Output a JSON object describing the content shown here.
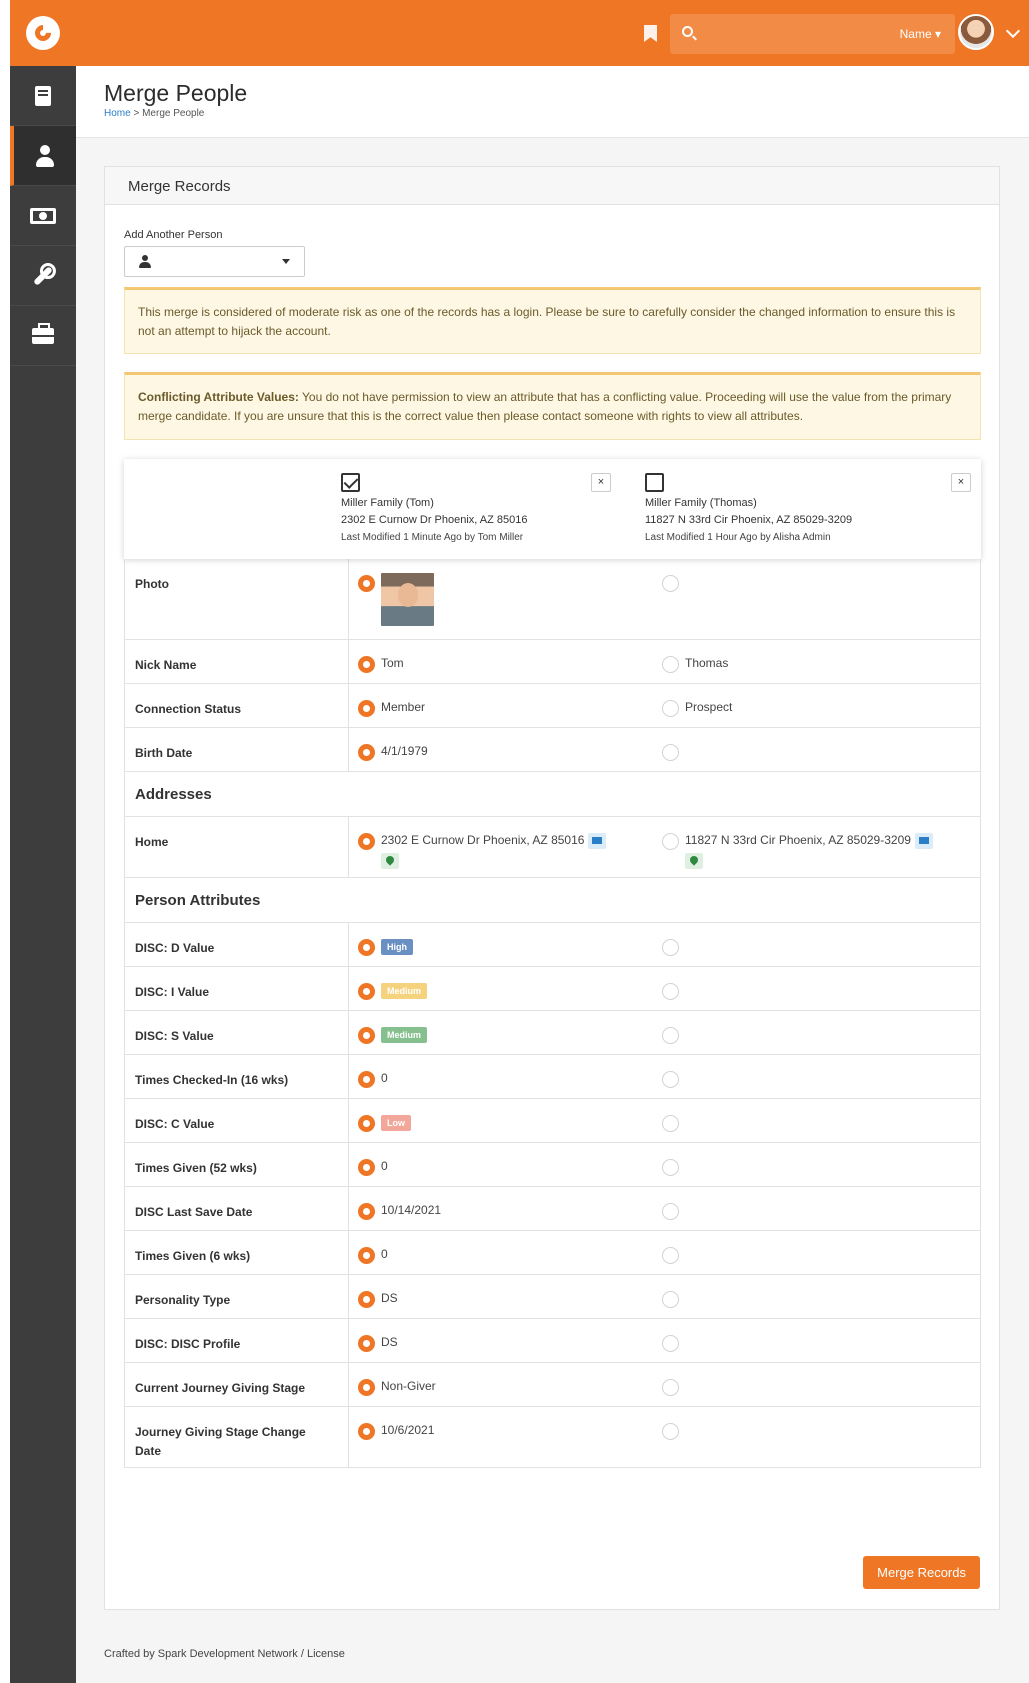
{
  "topbar": {
    "search_scope": "Name ▾",
    "colors": {
      "brand": "#ee7625",
      "sidebar": "#3d3d3d"
    }
  },
  "sidebar": {
    "items": [
      {
        "icon": "book-icon"
      },
      {
        "icon": "person-icon",
        "active": true
      },
      {
        "icon": "money-icon"
      },
      {
        "icon": "wrench-icon"
      },
      {
        "icon": "briefcase-icon"
      }
    ]
  },
  "page": {
    "title": "Merge People",
    "breadcrumb_home": "Home",
    "breadcrumb_sep": ">",
    "breadcrumb_current": "Merge People"
  },
  "panel": {
    "title": "Merge Records",
    "add_person_label": "Add Another Person",
    "alert_risk": "This merge is considered of moderate risk as one of the records has a login. Please be sure to carefully consider the changed information to ensure this is not an attempt to hijack the account.",
    "alert_conflict_title": "Conflicting Attribute Values:",
    "alert_conflict_body": " You do not have permission to view an attribute that has a conflicting value. Proceeding will use the value from the primary merge candidate. If you are unsure that this is the correct value then please contact someone with rights to view all attributes.",
    "merge_button": "Merge Records"
  },
  "candidates": [
    {
      "family": "Miller Family (Tom)",
      "address": "2302 E Curnow Dr Phoenix, AZ 85016",
      "modified": "Last Modified 1 Minute Ago by Tom Miller",
      "checked": true,
      "remove": "×"
    },
    {
      "family": "Miller Family (Thomas)",
      "address": "11827 N 33rd Cir Phoenix, AZ 85029-3209",
      "modified": "Last Modified 1 Hour Ago by Alisha Admin",
      "checked": false,
      "remove": "×"
    }
  ],
  "rows": {
    "photo": {
      "label": "Photo"
    },
    "nick": {
      "label": "Nick Name",
      "v1": "Tom",
      "v2": "Thomas"
    },
    "conn": {
      "label": "Connection Status",
      "v1": "Member",
      "v2": "Prospect"
    },
    "birth": {
      "label": "Birth Date",
      "v1": "4/1/1979"
    },
    "addresses": {
      "label": "Addresses"
    },
    "home": {
      "label": "Home",
      "v1": "2302 E Curnow Dr Phoenix, AZ 85016",
      "v2": "11827 N 33rd Cir Phoenix, AZ 85029-3209"
    },
    "attrs": {
      "label": "Person Attributes"
    },
    "disc_d": {
      "label": "DISC: D Value",
      "v1": "High",
      "color": "#6a8fc2"
    },
    "disc_i": {
      "label": "DISC: I Value",
      "v1": "Medium",
      "color": "#f5d27e"
    },
    "disc_s": {
      "label": "DISC: S Value",
      "v1": "Medium",
      "color": "#87c08f"
    },
    "checked_in": {
      "label": "Times Checked-In (16 wks)",
      "v1": "0"
    },
    "disc_c": {
      "label": "DISC: C Value",
      "v1": "Low",
      "color": "#f2a79a"
    },
    "given52": {
      "label": "Times Given (52 wks)",
      "v1": "0"
    },
    "disc_save": {
      "label": "DISC Last Save Date",
      "v1": "10/14/2021"
    },
    "given6": {
      "label": "Times Given (6 wks)",
      "v1": "0"
    },
    "ptype": {
      "label": "Personality Type",
      "v1": "DS"
    },
    "disc_profile": {
      "label": "DISC: DISC Profile",
      "v1": "DS"
    },
    "journey": {
      "label": "Current Journey Giving Stage",
      "v1": "Non-Giver"
    },
    "journey_date": {
      "label": "Journey Giving Stage Change Date",
      "v1": "10/6/2021"
    }
  },
  "footer": {
    "text": "Crafted by Spark Development Network / License"
  }
}
